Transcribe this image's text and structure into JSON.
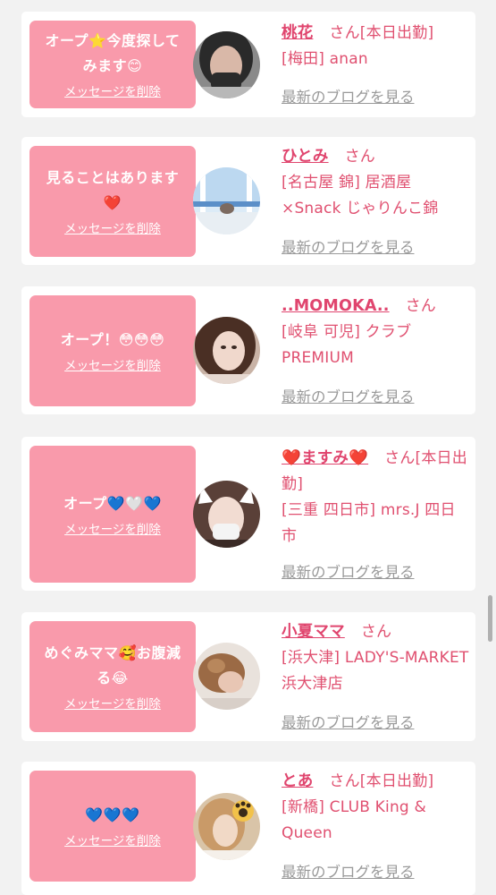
{
  "delete_label": "メッセージを削除",
  "blog_label": "最新のブログを見る",
  "cards": [
    {
      "message": "オープ⭐今度探してみます😊",
      "name": "桃花",
      "suffix": "さん[本日出勤]",
      "shop": "[梅田] anan"
    },
    {
      "message": "見ることはあります❤️",
      "name": "ひとみ",
      "suffix": "さん",
      "shop": "[名古屋 錦] 居酒屋×Snack じゃりんこ錦"
    },
    {
      "message": "オープ！😳😳😳",
      "name": "..MOMOKA..",
      "suffix": "さん",
      "shop": "[岐阜 可児] クラブPREMIUM"
    },
    {
      "message": "オープ💙🤍💙",
      "name": "❤️ますみ❤️",
      "suffix": "さん[本日出勤]",
      "shop": "[三重 四日市] mrs.J 四日市"
    },
    {
      "message": "めぐみママ🥰お腹減る😂",
      "name": "小夏ママ",
      "suffix": "さん",
      "shop": "[浜大津] LADY'S-MARKET 浜大津店"
    },
    {
      "message": "💙💙💙",
      "name": "とあ",
      "suffix": "さん[本日出勤]",
      "shop": "[新橋] CLUB King & Queen"
    }
  ]
}
